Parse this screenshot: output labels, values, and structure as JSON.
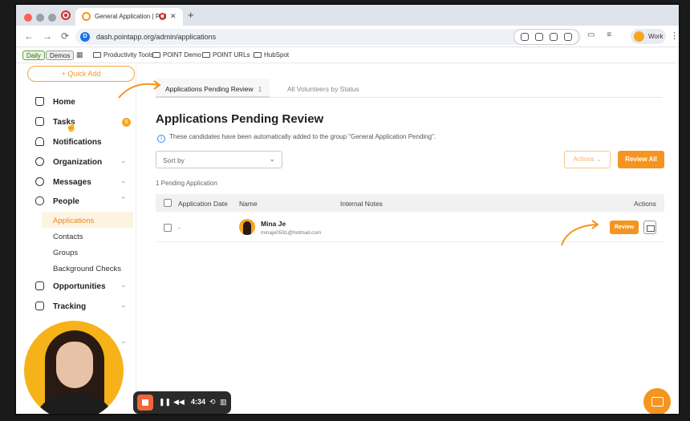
{
  "browser": {
    "tab_title": "General Application | POI",
    "url": "dash.pointapp.org/admin/applications",
    "profile": "Work",
    "bookmarks": {
      "daily": "Daily",
      "demos": "Demos",
      "items": [
        "Productivity Tools",
        "POINT Demo",
        "POINT URLs",
        "HubSpot"
      ]
    }
  },
  "sidebar": {
    "quick_add": "+ Quick Add",
    "nav": [
      {
        "label": "Home",
        "icon": "home-icon"
      },
      {
        "label": "Tasks",
        "icon": "tasks-icon",
        "badge": "5"
      },
      {
        "label": "Notifications",
        "icon": "bell-icon"
      },
      {
        "label": "Organization",
        "icon": "organization-icon"
      },
      {
        "label": "Messages",
        "icon": "message-icon"
      },
      {
        "label": "People",
        "icon": "hand-icon"
      }
    ],
    "people_sub": [
      "Applications",
      "Contacts",
      "Groups",
      "Background Checks"
    ],
    "nav_bottom": [
      {
        "label": "Opportunities",
        "icon": "calendar-icon"
      },
      {
        "label": "Tracking",
        "icon": "tracking-icon"
      }
    ]
  },
  "main": {
    "tabs": [
      {
        "label": "Applications Pending Review",
        "count": "1"
      },
      {
        "label": "All Volunteers by Status"
      }
    ],
    "title": "Applications Pending Review",
    "info": "These candidates have been automatically added to the group \"General Application Pending\".",
    "sort_by": "Sort by",
    "actions_label": "Actions",
    "review_all_label": "Review All",
    "pending_count": "1 Pending Application",
    "columns": [
      "Application Date",
      "Name",
      "Internal Notes",
      "Actions"
    ],
    "rows": [
      {
        "date": "-",
        "name": "Mina Je",
        "email": "minaje0591@hotmail.com",
        "review_label": "Review"
      }
    ]
  },
  "recorder": {
    "time": "4:34"
  },
  "colors": {
    "accent": "#f5951f",
    "active_bg": "#fef3e2"
  }
}
